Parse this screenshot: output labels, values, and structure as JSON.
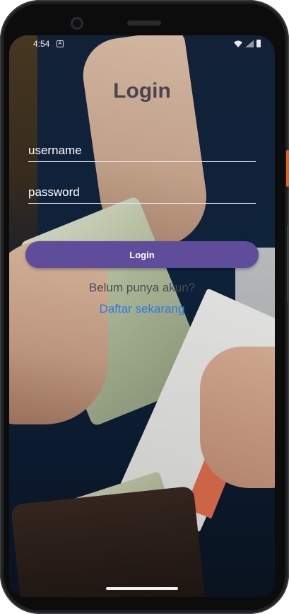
{
  "status_bar": {
    "time": "4:54",
    "notification_badge": "A",
    "icons": [
      "wifi-icon",
      "signal-icon",
      "battery-icon"
    ]
  },
  "screen": {
    "title": "Login",
    "username_placeholder": "username",
    "password_placeholder": "password",
    "login_button": "Login",
    "prompt_text": "Belum punya akun?",
    "register_link": "Daftar sekarang"
  },
  "colors": {
    "button": "#5f4d9c",
    "link": "#2c7ce0",
    "title": "#4a4450"
  }
}
